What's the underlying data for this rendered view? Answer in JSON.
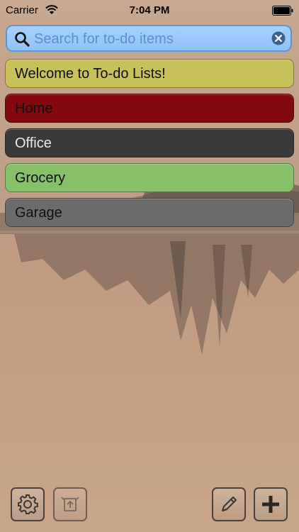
{
  "status_bar": {
    "carrier": "Carrier",
    "time": "7:04 PM",
    "wifi_icon": "wifi-icon",
    "battery_icon": "battery-icon"
  },
  "search": {
    "placeholder": "Search for to-do items",
    "value": "",
    "icon": "search-icon",
    "clear_icon": "clear-icon"
  },
  "lists": [
    {
      "label": "Welcome to To-do Lists!",
      "color": "#c8c15a",
      "text_color": "#111111"
    },
    {
      "label": "Home",
      "color": "#830a0c",
      "text_color": "#111111"
    },
    {
      "label": "Office",
      "color": "#3a3a3a",
      "text_color": "#e8e8e8"
    },
    {
      "label": "Grocery",
      "color": "#86c169",
      "text_color": "#111111"
    },
    {
      "label": "Garage",
      "color": "#6b6b6b",
      "text_color": "#111111"
    }
  ],
  "toolbar": {
    "settings_icon": "gear-icon",
    "share_icon": "share-icon",
    "edit_icon": "pencil-icon",
    "add_icon": "plus-icon"
  }
}
